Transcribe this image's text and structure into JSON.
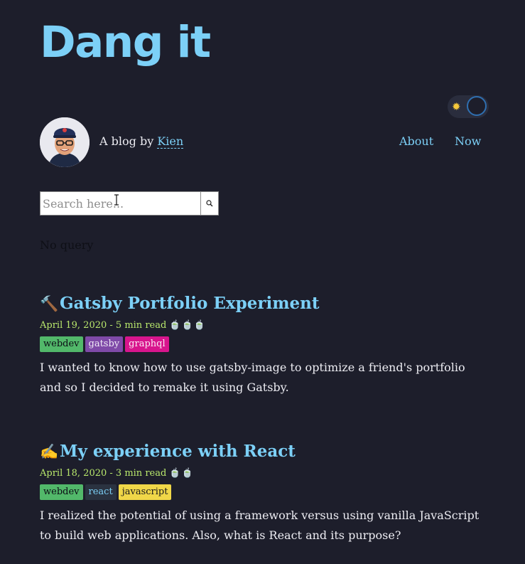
{
  "site": {
    "title": "Dang it"
  },
  "theme_toggle": {
    "icon": "sun-icon"
  },
  "header": {
    "byline_prefix": "A blog by ",
    "author": "Kien",
    "nav": [
      {
        "label": "About"
      },
      {
        "label": "Now"
      }
    ]
  },
  "search": {
    "placeholder": "Search here...",
    "value": "",
    "button_icon": "search-icon",
    "status": "No query"
  },
  "posts": [
    {
      "emoji": "🔨",
      "title": "Gatsby Portfolio Experiment",
      "meta": "April 19, 2020 - 5 min read",
      "read_cups": 3,
      "tags": [
        {
          "label": "webdev",
          "color": "#52b86a"
        },
        {
          "label": "gatsby",
          "color": "#7f4aa8"
        },
        {
          "label": "graphql",
          "color": "#d8158d"
        }
      ],
      "excerpt": "I wanted to know how to use gatsby-image to optimize a friend's portfolio and so I decided to remake it using Gatsby."
    },
    {
      "emoji": "✍️",
      "title": "My experience with React",
      "meta": "April 18, 2020 - 3 min read",
      "read_cups": 2,
      "tags": [
        {
          "label": "webdev",
          "color": "#52b86a"
        },
        {
          "label": "react",
          "color": "#2a3240"
        },
        {
          "label": "javascript",
          "color": "#f0d748"
        }
      ],
      "excerpt": "I realized the potential of using a framework versus using vanilla JavaScript to build web applications. Also, what is React and its purpose?"
    }
  ],
  "colors": {
    "background": "#1d1e2b",
    "accent": "#7cd0f7",
    "meta": "#b9e86c"
  }
}
